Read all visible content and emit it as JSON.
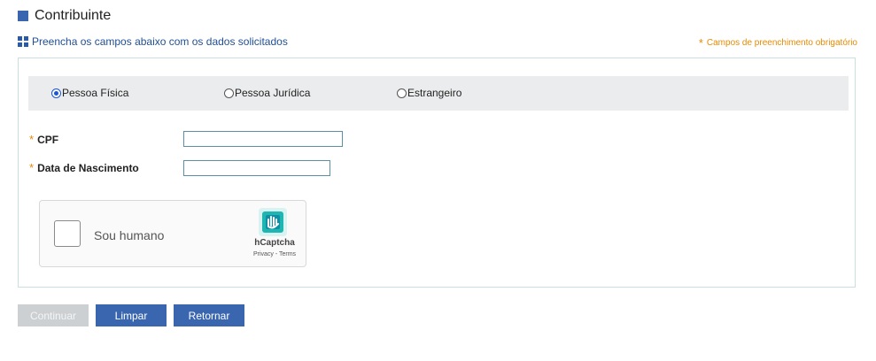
{
  "header": {
    "title": "Contribuinte",
    "subtitle": "Preencha os campos abaixo com os dados solicitados",
    "required_note": "Campos de preenchimento obrigatório",
    "required_marker": "*"
  },
  "person_type": {
    "options": [
      {
        "label": "Pessoa Física",
        "checked": true
      },
      {
        "label": "Pessoa Jurídica",
        "checked": false
      },
      {
        "label": "Estrangeiro",
        "checked": false
      }
    ]
  },
  "fields": {
    "cpf": {
      "label": "CPF",
      "value": ""
    },
    "birth_date": {
      "label": "Data de Nascimento",
      "value": ""
    }
  },
  "captcha": {
    "label": "Sou humano",
    "brand": "hCaptcha",
    "links": "Privacy - Terms"
  },
  "buttons": {
    "continue": "Continuar",
    "clear": "Limpar",
    "back": "Retornar"
  },
  "colors": {
    "primary": "#3a66b0",
    "accent": "#e68a00",
    "disabled": "#cdd0d3"
  },
  "icons": {
    "title": "square-icon",
    "subtitle": "grid-icon",
    "required": "asterisk-icon",
    "captcha": "hcaptcha-logo-icon"
  }
}
